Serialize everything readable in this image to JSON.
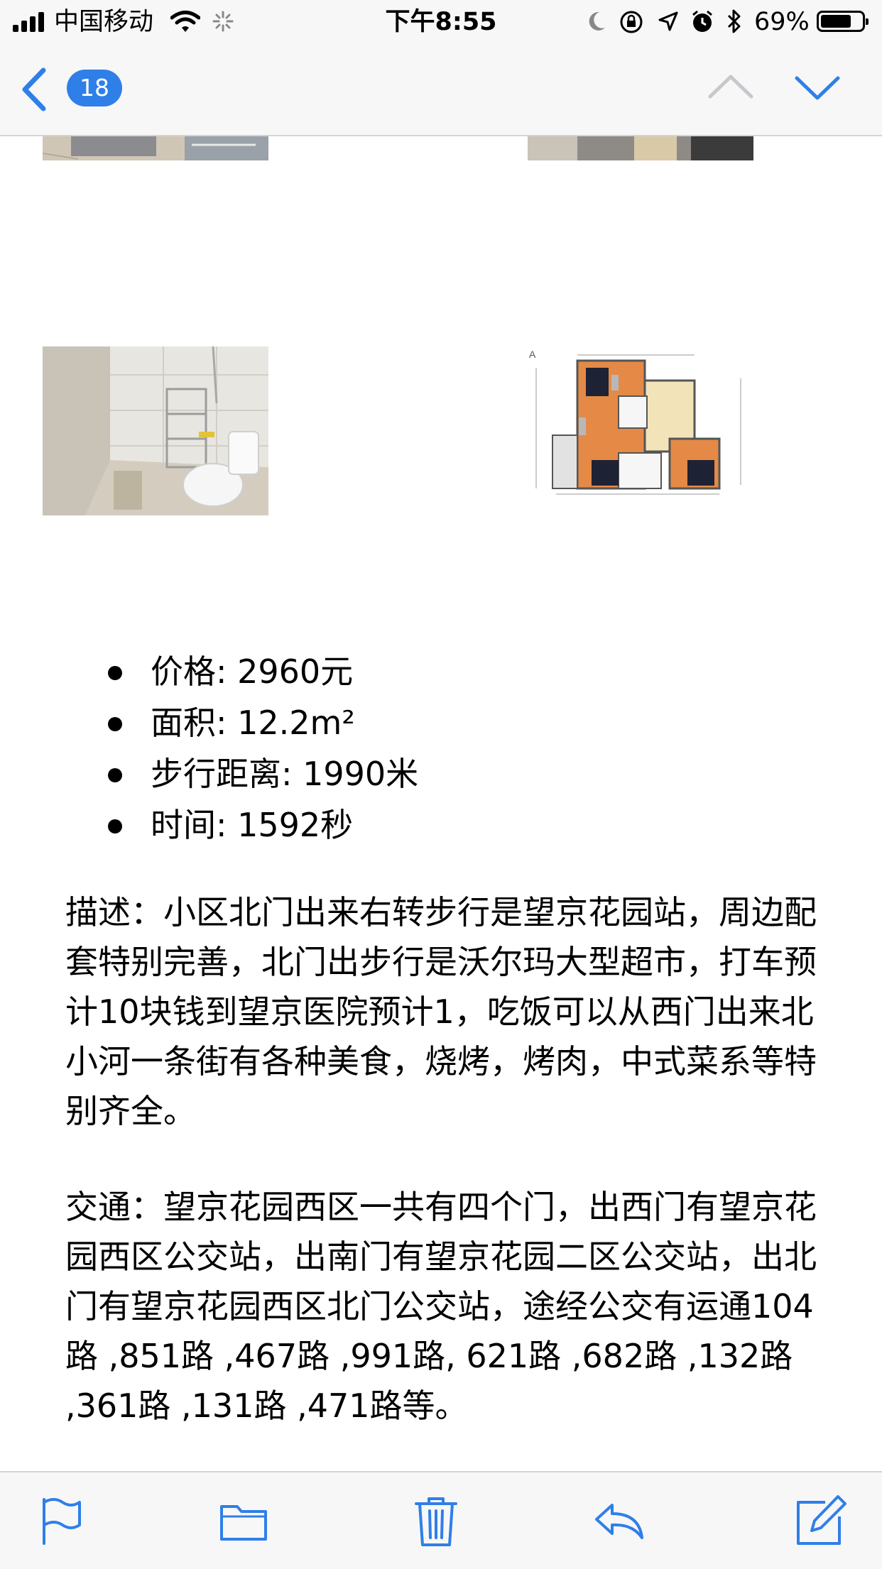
{
  "status_bar": {
    "carrier": "中国移动",
    "time": "下午8:55",
    "battery": "69%"
  },
  "nav": {
    "unread_count": "18",
    "icons": [
      "chevron-left-icon",
      "chevron-up-icon",
      "chevron-down-icon"
    ],
    "accent_color": "#2f7fe8"
  },
  "listing": {
    "details": [
      "价格: 2960元",
      "面积: 12.2m²",
      "步行距离: 1990米",
      "时间: 1592秒"
    ],
    "description": "描述：小区北门出来右转步行是望京花园站，周边配套特别完善，北门出步行是沃尔玛大型超市，打车预计10块钱到望京医院预计1，吃饭可以从西门出来北小河一条街有各种美食，烧烤，烤肉，中式菜系等特别齐全。",
    "transport": "交通：望京花园西区一共有四个门，出西门有望京花园西区公交站，出南门有望京花园二区公交站，出北门有望京花园西区北门公交站，途经公交有运通104路 ,851路 ,467路 ,991路, 621路 ,682路 ,132路 ,361路 ,131路 ,471路等。"
  },
  "toolbar": {
    "icons": [
      "flag-icon",
      "folder-icon",
      "trash-icon",
      "reply-icon",
      "compose-icon"
    ]
  }
}
